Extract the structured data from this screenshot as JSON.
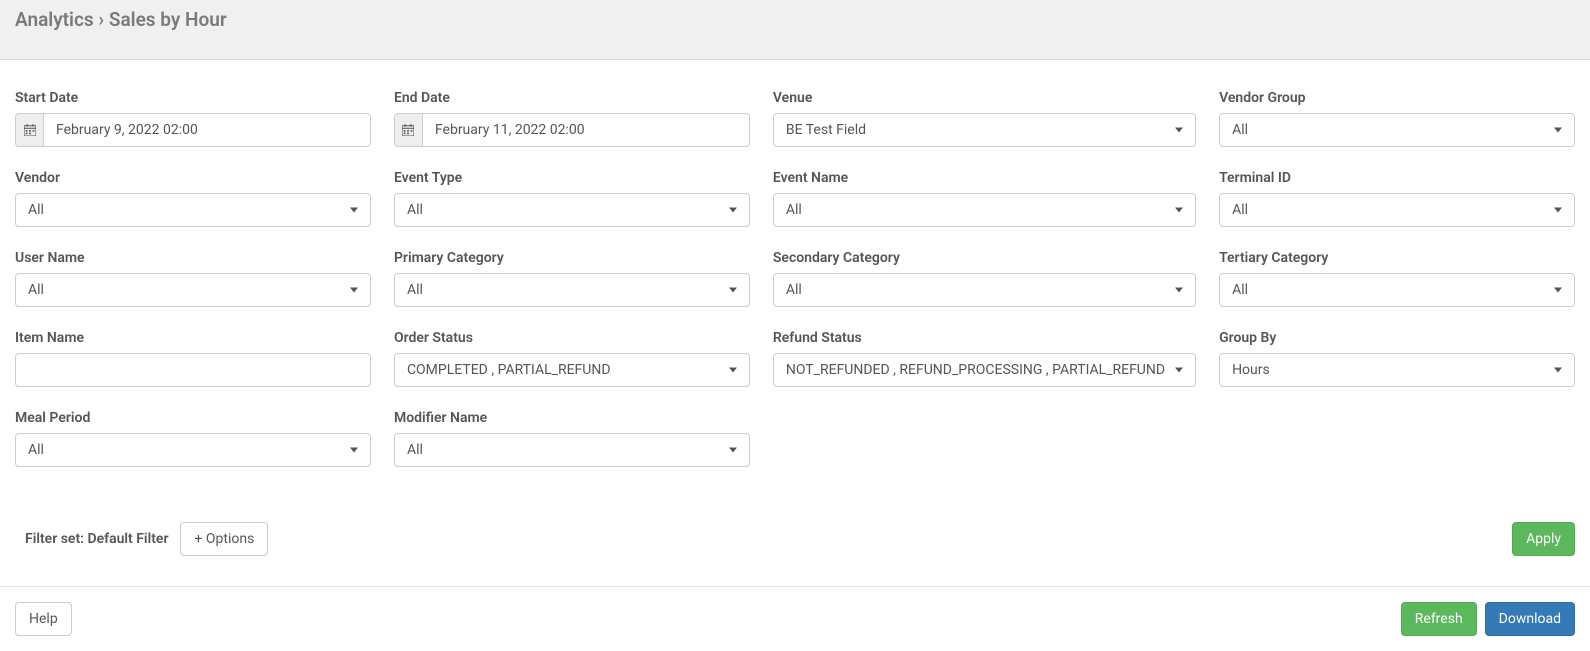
{
  "header": {
    "breadcrumb_root": "Analytics",
    "breadcrumb_sep": "›",
    "breadcrumb_current": "Sales by Hour"
  },
  "filters": {
    "start_date": {
      "label": "Start Date",
      "value": "February 9, 2022 02:00"
    },
    "end_date": {
      "label": "End Date",
      "value": "February 11, 2022 02:00"
    },
    "venue": {
      "label": "Venue",
      "value": "BE Test Field"
    },
    "vendor_group": {
      "label": "Vendor Group",
      "value": "All"
    },
    "vendor": {
      "label": "Vendor",
      "value": "All"
    },
    "event_type": {
      "label": "Event Type",
      "value": "All"
    },
    "event_name": {
      "label": "Event Name",
      "value": "All"
    },
    "terminal_id": {
      "label": "Terminal ID",
      "value": "All"
    },
    "user_name": {
      "label": "User Name",
      "value": "All"
    },
    "primary_category": {
      "label": "Primary Category",
      "value": "All"
    },
    "secondary_category": {
      "label": "Secondary Category",
      "value": "All"
    },
    "tertiary_category": {
      "label": "Tertiary Category",
      "value": "All"
    },
    "item_name": {
      "label": "Item Name",
      "value": ""
    },
    "order_status": {
      "label": "Order Status",
      "value": "COMPLETED , PARTIAL_REFUND"
    },
    "refund_status": {
      "label": "Refund Status",
      "value": "NOT_REFUNDED , REFUND_PROCESSING , PARTIAL_REFUND"
    },
    "group_by": {
      "label": "Group By",
      "value": "Hours"
    },
    "meal_period": {
      "label": "Meal Period",
      "value": "All"
    },
    "modifier_name": {
      "label": "Modifier Name",
      "value": "All"
    }
  },
  "filter_set": {
    "label": "Filter set: Default Filter",
    "options_button": "+ Options"
  },
  "buttons": {
    "apply": "Apply",
    "help": "Help",
    "refresh": "Refresh",
    "download": "Download"
  }
}
